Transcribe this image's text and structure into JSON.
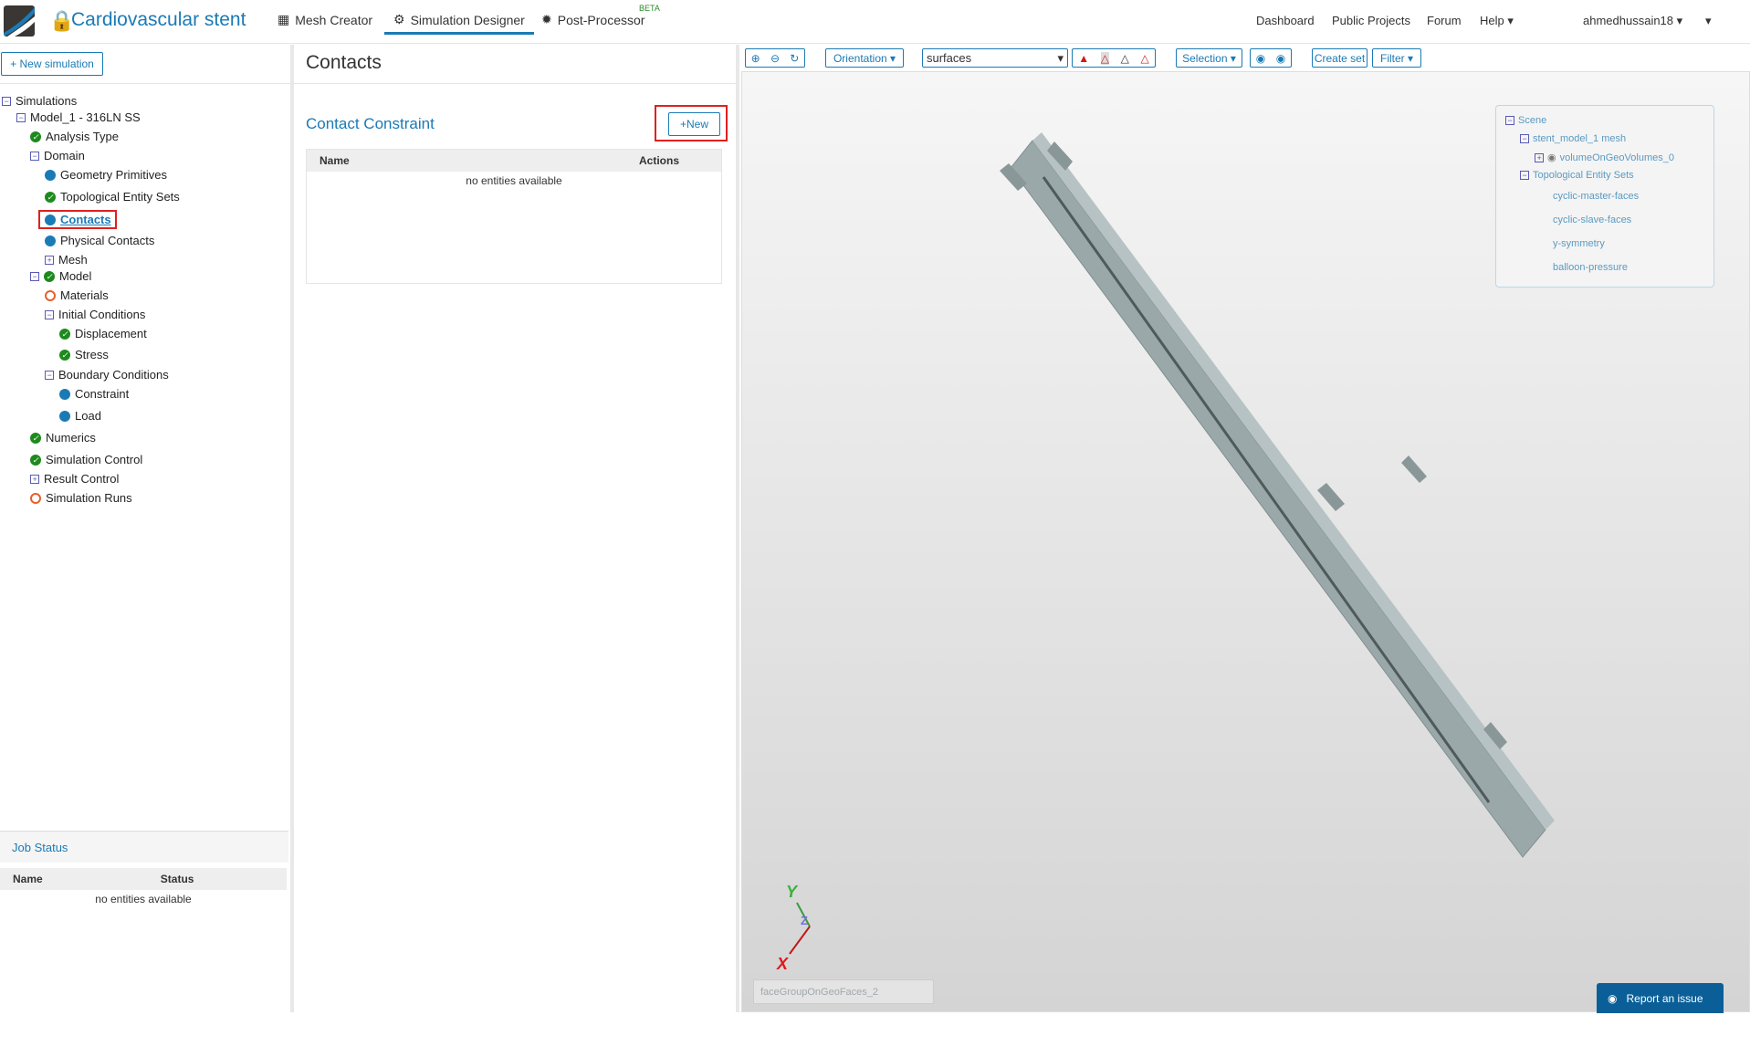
{
  "header": {
    "title": "Cardiovascular stent",
    "nav": [
      "Mesh Creator",
      "Simulation Designer",
      "Post-Processor"
    ],
    "beta": "BETA",
    "links": [
      "Dashboard",
      "Public Projects",
      "Forum",
      "Help"
    ],
    "user": "ahmedhussain18"
  },
  "left": {
    "new_simulation": "New simulation",
    "tree": [
      "Simulations",
      "Model_1 - 316LN SS",
      "Analysis Type",
      "Domain",
      "Geometry Primitives",
      "Topological Entity Sets",
      "Contacts",
      "Physical Contacts",
      "Mesh",
      "Model",
      "Materials",
      "Initial Conditions",
      "Displacement",
      "Stress",
      "Boundary Conditions",
      "Constraint",
      "Load",
      "Numerics",
      "Simulation Control",
      "Result Control",
      "Simulation Runs"
    ],
    "job_status": {
      "title": "Job Status",
      "columns": [
        "Name",
        "Status"
      ],
      "empty": "no entities available"
    }
  },
  "middle": {
    "title": "Contacts",
    "section": "Contact Constraint",
    "new_label": "New",
    "columns": [
      "Name",
      "Actions"
    ],
    "empty": "no entities available"
  },
  "toolbar": {
    "orientation": "Orientation",
    "render_mode": "surfaces",
    "selection": "Selection",
    "create_set": "Create set",
    "filter": "Filter"
  },
  "scene": {
    "root": "Scene",
    "mesh": "stent_model_1 mesh",
    "volume": "volumeOnGeoVolumes_0",
    "sets_label": "Topological Entity Sets",
    "sets": [
      "cyclic-master-faces",
      "cyclic-slave-faces",
      "y-symmetry",
      "balloon-pressure"
    ]
  },
  "viewport": {
    "axes": [
      "Y",
      "Z",
      "X"
    ],
    "selection_box": "faceGroupOnGeoFaces_2",
    "report": "Report an issue"
  },
  "colors": {
    "accent": "#1a7ab5",
    "ok": "#1e8a1e",
    "pending": "#e4602a",
    "highlight": "#e02020"
  }
}
